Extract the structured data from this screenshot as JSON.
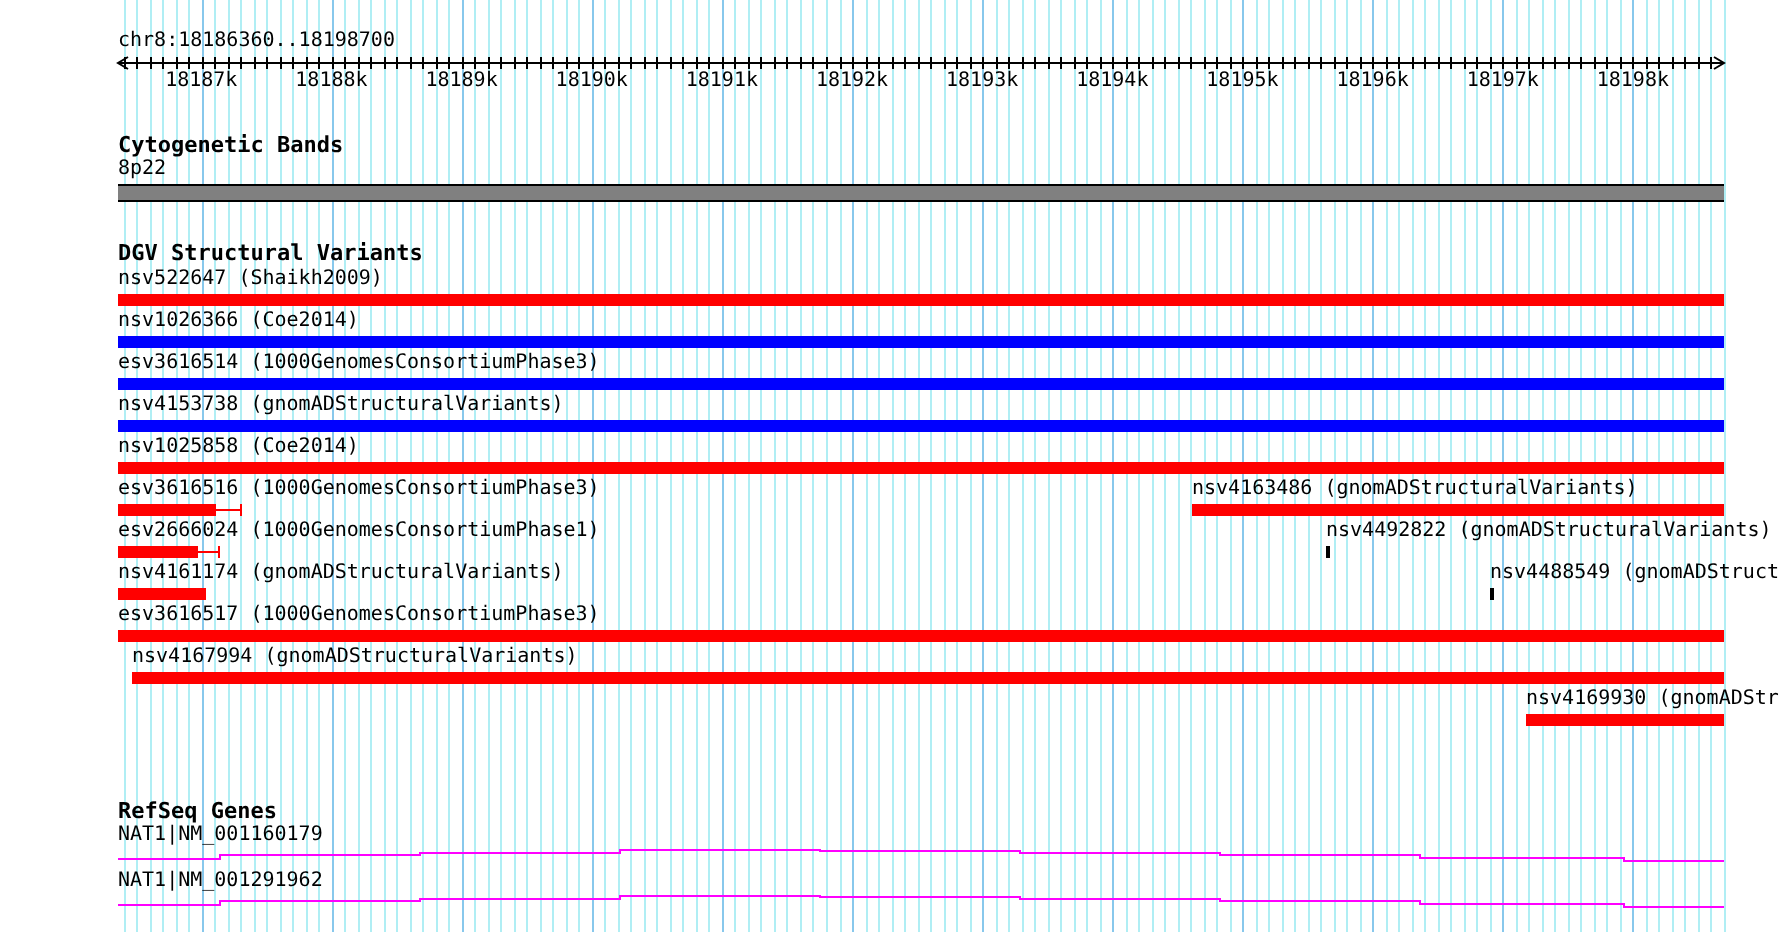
{
  "location": "chr8:18186360..18198700",
  "ruler": {
    "labels": [
      "18187k",
      "18188k",
      "18189k",
      "18190k",
      "18191k",
      "18192k",
      "18193k",
      "18194k",
      "18195k",
      "18196k",
      "18197k",
      "18198k"
    ]
  },
  "tracks": [
    {
      "kind": "bands",
      "title": "Cytogenetic Bands",
      "features": [
        {
          "label": "8p22"
        }
      ]
    },
    {
      "kind": "variants",
      "title": "DGV Structural Variants",
      "features": [
        {
          "label": "nsv522647 (Shaikh2009)",
          "color": "#ff0000"
        },
        {
          "label": "nsv1026366 (Coe2014)",
          "color": "#0000ff"
        },
        {
          "label": "esv3616514 (1000GenomesConsortiumPhase3)",
          "color": "#0000ff"
        },
        {
          "label": "nsv4153738 (gnomADStructuralVariants)",
          "color": "#0000ff"
        },
        {
          "label": "nsv1025858 (Coe2014)",
          "color": "#ff0000"
        },
        {
          "label": "esv3616516 (1000GenomesConsortiumPhase3)",
          "color": "#ff0000"
        },
        {
          "label": "nsv4163486 (gnomADStructuralVariants)",
          "color": "#ff0000"
        },
        {
          "label": "esv2666024 (1000GenomesConsortiumPhase1)",
          "color": "#ff0000"
        },
        {
          "label": "nsv4492822 (gnomADStructuralVariants)",
          "color": "#000000"
        },
        {
          "label": "nsv4161174 (gnomADStructuralVariants)",
          "color": "#ff0000"
        },
        {
          "label": "nsv4488549 (gnomADStruct",
          "color": "#000000"
        },
        {
          "label": "esv3616517 (1000GenomesConsortiumPhase3)",
          "color": "#ff0000"
        },
        {
          "label": "nsv4167994 (gnomADStructuralVariants)",
          "color": "#ff0000"
        },
        {
          "label": "nsv4169930 (gnomADStr",
          "color": "#ff0000"
        }
      ]
    },
    {
      "kind": "genes",
      "title": "RefSeq Genes",
      "features": [
        {
          "label": "NAT1|NM_001160179"
        },
        {
          "label": "NAT1|NM_001291962"
        }
      ]
    }
  ]
}
